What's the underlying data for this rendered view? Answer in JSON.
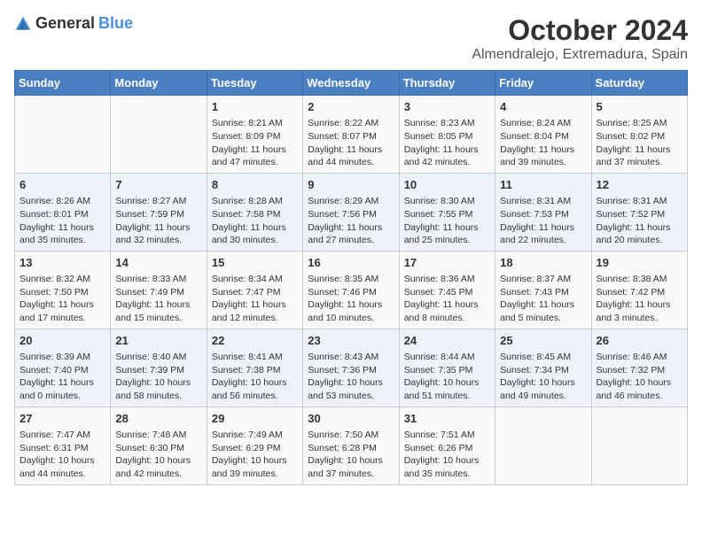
{
  "header": {
    "logo_general": "General",
    "logo_blue": "Blue",
    "month": "October 2024",
    "location": "Almendralejo, Extremadura, Spain"
  },
  "weekdays": [
    "Sunday",
    "Monday",
    "Tuesday",
    "Wednesday",
    "Thursday",
    "Friday",
    "Saturday"
  ],
  "weeks": [
    [
      {
        "day": "",
        "info": ""
      },
      {
        "day": "",
        "info": ""
      },
      {
        "day": "1",
        "info": "Sunrise: 8:21 AM\nSunset: 8:09 PM\nDaylight: 11 hours and 47 minutes."
      },
      {
        "day": "2",
        "info": "Sunrise: 8:22 AM\nSunset: 8:07 PM\nDaylight: 11 hours and 44 minutes."
      },
      {
        "day": "3",
        "info": "Sunrise: 8:23 AM\nSunset: 8:05 PM\nDaylight: 11 hours and 42 minutes."
      },
      {
        "day": "4",
        "info": "Sunrise: 8:24 AM\nSunset: 8:04 PM\nDaylight: 11 hours and 39 minutes."
      },
      {
        "day": "5",
        "info": "Sunrise: 8:25 AM\nSunset: 8:02 PM\nDaylight: 11 hours and 37 minutes."
      }
    ],
    [
      {
        "day": "6",
        "info": "Sunrise: 8:26 AM\nSunset: 8:01 PM\nDaylight: 11 hours and 35 minutes."
      },
      {
        "day": "7",
        "info": "Sunrise: 8:27 AM\nSunset: 7:59 PM\nDaylight: 11 hours and 32 minutes."
      },
      {
        "day": "8",
        "info": "Sunrise: 8:28 AM\nSunset: 7:58 PM\nDaylight: 11 hours and 30 minutes."
      },
      {
        "day": "9",
        "info": "Sunrise: 8:29 AM\nSunset: 7:56 PM\nDaylight: 11 hours and 27 minutes."
      },
      {
        "day": "10",
        "info": "Sunrise: 8:30 AM\nSunset: 7:55 PM\nDaylight: 11 hours and 25 minutes."
      },
      {
        "day": "11",
        "info": "Sunrise: 8:31 AM\nSunset: 7:53 PM\nDaylight: 11 hours and 22 minutes."
      },
      {
        "day": "12",
        "info": "Sunrise: 8:31 AM\nSunset: 7:52 PM\nDaylight: 11 hours and 20 minutes."
      }
    ],
    [
      {
        "day": "13",
        "info": "Sunrise: 8:32 AM\nSunset: 7:50 PM\nDaylight: 11 hours and 17 minutes."
      },
      {
        "day": "14",
        "info": "Sunrise: 8:33 AM\nSunset: 7:49 PM\nDaylight: 11 hours and 15 minutes."
      },
      {
        "day": "15",
        "info": "Sunrise: 8:34 AM\nSunset: 7:47 PM\nDaylight: 11 hours and 12 minutes."
      },
      {
        "day": "16",
        "info": "Sunrise: 8:35 AM\nSunset: 7:46 PM\nDaylight: 11 hours and 10 minutes."
      },
      {
        "day": "17",
        "info": "Sunrise: 8:36 AM\nSunset: 7:45 PM\nDaylight: 11 hours and 8 minutes."
      },
      {
        "day": "18",
        "info": "Sunrise: 8:37 AM\nSunset: 7:43 PM\nDaylight: 11 hours and 5 minutes."
      },
      {
        "day": "19",
        "info": "Sunrise: 8:38 AM\nSunset: 7:42 PM\nDaylight: 11 hours and 3 minutes."
      }
    ],
    [
      {
        "day": "20",
        "info": "Sunrise: 8:39 AM\nSunset: 7:40 PM\nDaylight: 11 hours and 0 minutes."
      },
      {
        "day": "21",
        "info": "Sunrise: 8:40 AM\nSunset: 7:39 PM\nDaylight: 10 hours and 58 minutes."
      },
      {
        "day": "22",
        "info": "Sunrise: 8:41 AM\nSunset: 7:38 PM\nDaylight: 10 hours and 56 minutes."
      },
      {
        "day": "23",
        "info": "Sunrise: 8:43 AM\nSunset: 7:36 PM\nDaylight: 10 hours and 53 minutes."
      },
      {
        "day": "24",
        "info": "Sunrise: 8:44 AM\nSunset: 7:35 PM\nDaylight: 10 hours and 51 minutes."
      },
      {
        "day": "25",
        "info": "Sunrise: 8:45 AM\nSunset: 7:34 PM\nDaylight: 10 hours and 49 minutes."
      },
      {
        "day": "26",
        "info": "Sunrise: 8:46 AM\nSunset: 7:32 PM\nDaylight: 10 hours and 46 minutes."
      }
    ],
    [
      {
        "day": "27",
        "info": "Sunrise: 7:47 AM\nSunset: 6:31 PM\nDaylight: 10 hours and 44 minutes."
      },
      {
        "day": "28",
        "info": "Sunrise: 7:48 AM\nSunset: 6:30 PM\nDaylight: 10 hours and 42 minutes."
      },
      {
        "day": "29",
        "info": "Sunrise: 7:49 AM\nSunset: 6:29 PM\nDaylight: 10 hours and 39 minutes."
      },
      {
        "day": "30",
        "info": "Sunrise: 7:50 AM\nSunset: 6:28 PM\nDaylight: 10 hours and 37 minutes."
      },
      {
        "day": "31",
        "info": "Sunrise: 7:51 AM\nSunset: 6:26 PM\nDaylight: 10 hours and 35 minutes."
      },
      {
        "day": "",
        "info": ""
      },
      {
        "day": "",
        "info": ""
      }
    ]
  ]
}
